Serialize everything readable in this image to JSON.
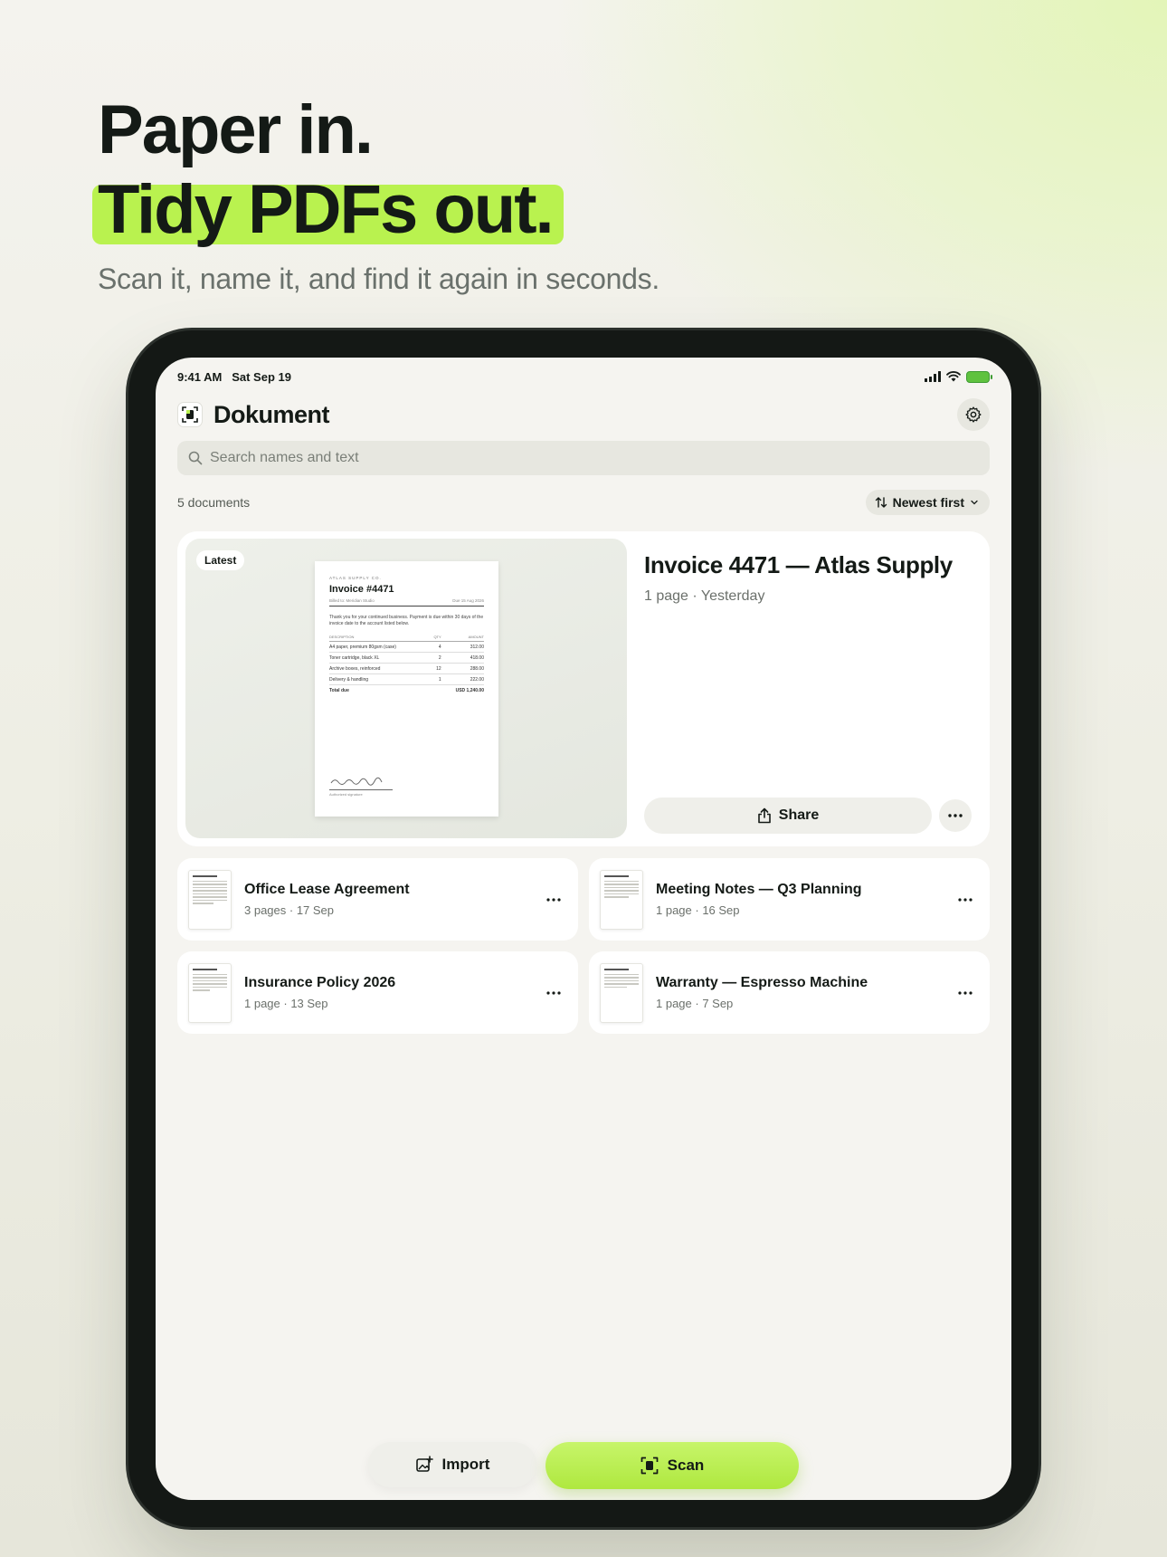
{
  "hero": {
    "line1": "Paper in.",
    "line2": "Tidy PDFs out.",
    "subtitle": "Scan it, name it, and find it again in seconds."
  },
  "status_bar": {
    "time": "9:41 AM",
    "date": "Sat Sep 19"
  },
  "app": {
    "title": "Dokument"
  },
  "search": {
    "placeholder": "Search names and text",
    "value": ""
  },
  "list_header": {
    "count_label": "5 documents",
    "sort_label": "Newest first"
  },
  "featured": {
    "badge": "Latest",
    "title": "Invoice 4471 — Atlas Supply",
    "meta": "1 page · Yesterday",
    "share_label": "Share",
    "preview": {
      "company": "ATLAS SUPPLY CO.",
      "title": "Invoice #4471",
      "billed_to": "Billed to: Meridian Studio",
      "due": "Due 15 Aug 2026",
      "note": "Thank you for your continued business. Payment is due within 30 days of the invoice date to the account listed below.",
      "headers": [
        "DESCRIPTION",
        "QTY",
        "AMOUNT"
      ],
      "rows": [
        [
          "A4 paper, premium 80gsm (case)",
          "4",
          "312.00"
        ],
        [
          "Toner cartridge, black XL",
          "2",
          "418.00"
        ],
        [
          "Archive boxes, reinforced",
          "12",
          "288.00"
        ],
        [
          "Delivery & handling",
          "1",
          "222.00"
        ]
      ],
      "total_label": "Total due",
      "total_value": "USD 1,240.00",
      "signature_label": "Authorized signature"
    }
  },
  "documents": [
    {
      "title": "Office Lease Agreement",
      "meta": "3 pages · 17 Sep"
    },
    {
      "title": "Meeting Notes — Q3 Planning",
      "meta": "1 page · 16 Sep"
    },
    {
      "title": "Insurance Policy 2026",
      "meta": "1 page · 13 Sep"
    },
    {
      "title": "Warranty — Espresso Machine",
      "meta": "1 page · 7 Sep"
    }
  ],
  "actions": {
    "import_label": "Import",
    "scan_label": "Scan"
  },
  "colors": {
    "accent": "#b9f24f",
    "ink": "#141a16",
    "surface": "#f5f4f0"
  }
}
